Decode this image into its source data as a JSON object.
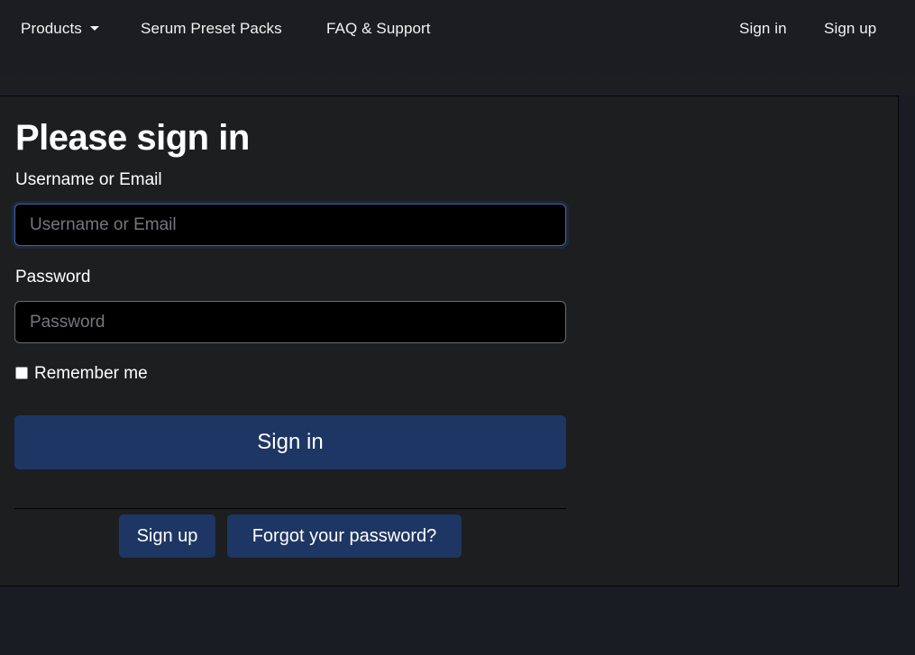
{
  "navbar": {
    "left_links": [
      {
        "label": "Products",
        "has_dropdown": true
      },
      {
        "label": "Serum Preset Packs"
      },
      {
        "label": "FAQ & Support"
      }
    ],
    "right_links": [
      {
        "label": "Sign in"
      },
      {
        "label": "Sign up"
      }
    ]
  },
  "form": {
    "title": "Please sign in",
    "username": {
      "label": "Username or Email",
      "placeholder": "Username or Email",
      "value": "",
      "focused": true
    },
    "password": {
      "label": "Password",
      "placeholder": "Password",
      "value": ""
    },
    "remember_me": {
      "label": "Remember me",
      "checked": false
    },
    "submit_label": "Sign in",
    "secondary_actions": [
      {
        "label": "Sign up"
      },
      {
        "label": "Forgot your password?"
      }
    ]
  },
  "colors": {
    "page_background": "#1a1c24",
    "card_background": "#1c1e20",
    "button_background": "#1d3663",
    "focus_border": "#3f63a8"
  }
}
